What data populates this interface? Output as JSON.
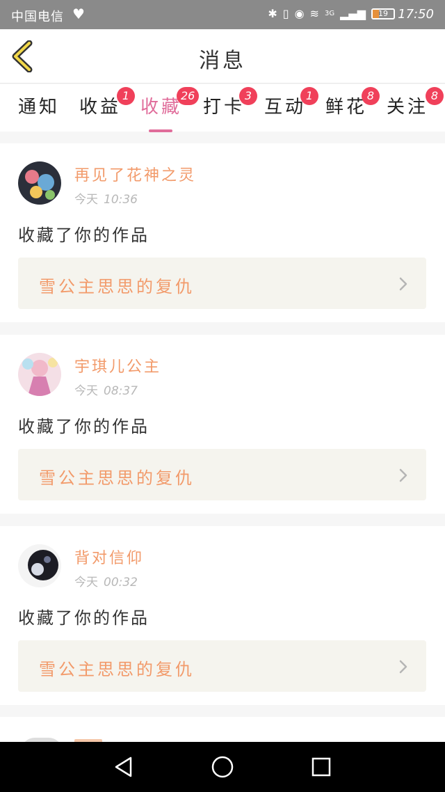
{
  "status_bar": {
    "carrier": "中国电信",
    "network": "3G",
    "battery": "19",
    "time": "17:50"
  },
  "header": {
    "title": "消息"
  },
  "tabs": [
    {
      "label": "通知",
      "badge": ""
    },
    {
      "label": "收益",
      "badge": "1"
    },
    {
      "label": "收藏",
      "badge": "26",
      "active": true
    },
    {
      "label": "打卡",
      "badge": "3"
    },
    {
      "label": "互动",
      "badge": "1"
    },
    {
      "label": "鲜花",
      "badge": "8"
    },
    {
      "label": "关注",
      "badge": "8"
    }
  ],
  "feed": [
    {
      "user": "再见了花神之灵",
      "day": "今天",
      "time": "10:36",
      "action": "收藏了你的作品",
      "work": "雪公主思思的复仇"
    },
    {
      "user": "宇琪儿公主",
      "day": "今天",
      "time": "08:37",
      "action": "收藏了你的作品",
      "work": "雪公主思思的复仇"
    },
    {
      "user": "背对信仰",
      "day": "今天",
      "time": "00:32",
      "action": "收藏了你的作品",
      "work": "雪公主思思的复仇"
    }
  ],
  "colors": {
    "accent": "#e06c9a",
    "badge": "#f0405a",
    "name": "#f29a6a",
    "link_bg": "#f5f4ee"
  },
  "icons": {
    "back": "chevron-left-icon",
    "link": "chevron-right-icon",
    "nav_back": "triangle-back-icon",
    "nav_home": "circle-home-icon",
    "nav_recent": "square-recent-icon"
  }
}
